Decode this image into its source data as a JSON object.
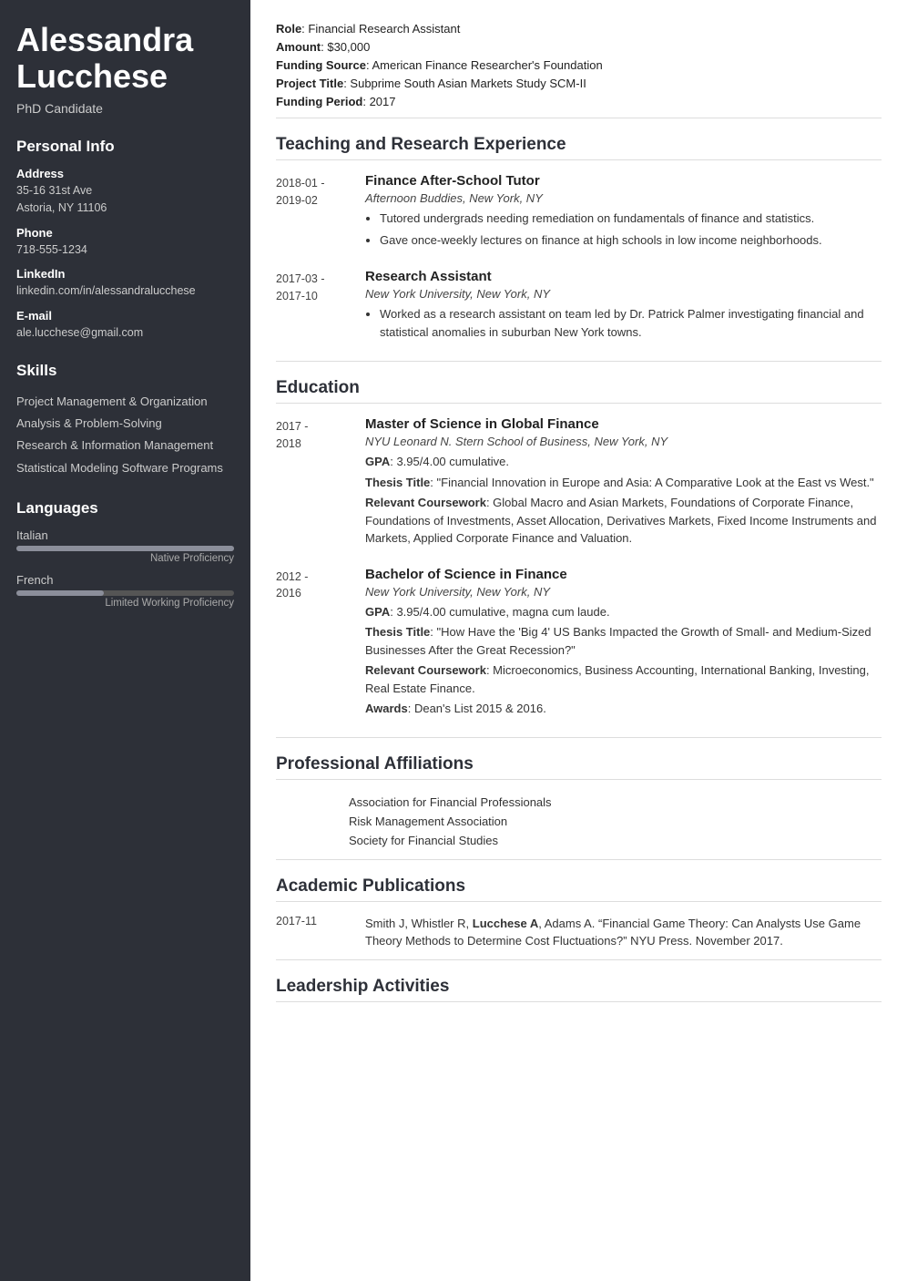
{
  "sidebar": {
    "name": "Alessandra Lucchese",
    "title": "PhD Candidate",
    "personal_info": {
      "section_title": "Personal Info",
      "address_label": "Address",
      "address_line1": "35-16 31st Ave",
      "address_line2": "Astoria, NY 11106",
      "phone_label": "Phone",
      "phone": "718-555-1234",
      "linkedin_label": "LinkedIn",
      "linkedin": "linkedin.com/in/alessandralucchese",
      "email_label": "E-mail",
      "email": "ale.lucchese@gmail.com"
    },
    "skills": {
      "section_title": "Skills",
      "items": [
        "Project Management & Organization",
        "Analysis & Problem-Solving",
        "Research & Information Management",
        "Statistical Modeling Software Programs"
      ]
    },
    "languages": {
      "section_title": "Languages",
      "items": [
        {
          "name": "Italian",
          "fill_pct": 100,
          "proficiency": "Native Proficiency"
        },
        {
          "name": "French",
          "fill_pct": 40,
          "proficiency": "Limited Working Proficiency"
        }
      ]
    }
  },
  "main": {
    "funding": {
      "role_label": "Role",
      "role": "Financial Research Assistant",
      "amount_label": "Amount",
      "amount": "$30,000",
      "funding_source_label": "Funding Source",
      "funding_source": "American Finance Researcher's Foundation",
      "project_title_label": "Project Title",
      "project_title": "Subprime South Asian Markets Study SCM-II",
      "funding_period_label": "Funding Period",
      "funding_period": "2017"
    },
    "teaching_section_title": "Teaching and Research Experience",
    "teaching": [
      {
        "date_start": "2018-01 -",
        "date_end": "2019-02",
        "title": "Finance After-School Tutor",
        "org": "Afternoon Buddies, New York, NY",
        "bullets": [
          "Tutored undergrads needing remediation on fundamentals of finance and statistics.",
          "Gave once-weekly lectures on finance at high schools in low income neighborhoods."
        ]
      },
      {
        "date_start": "2017-03 -",
        "date_end": "2017-10",
        "title": "Research Assistant",
        "org": "New York University, New York, NY",
        "bullets": [
          "Worked as a research assistant on team led by Dr. Patrick Palmer investigating financial and statistical anomalies in suburban New York towns."
        ]
      }
    ],
    "education_section_title": "Education",
    "education": [
      {
        "date_start": "2017 -",
        "date_end": "2018",
        "title": "Master of Science in Global Finance",
        "org": "NYU Leonard N. Stern School of Business, New York, NY",
        "gpa_label": "GPA",
        "gpa": "3.95/4.00 cumulative.",
        "thesis_label": "Thesis Title",
        "thesis": "\"Financial Innovation in Europe and Asia: A Comparative Look at the East vs West.\"",
        "coursework_label": "Relevant Coursework",
        "coursework": "Global Macro and Asian Markets, Foundations of Corporate Finance, Foundations of Investments, Asset Allocation, Derivatives Markets, Fixed Income Instruments and Markets, Applied Corporate Finance and Valuation.",
        "awards_label": null,
        "awards": null
      },
      {
        "date_start": "2012 -",
        "date_end": "2016",
        "title": "Bachelor of Science in Finance",
        "org": "New York University, New York, NY",
        "gpa_label": "GPA",
        "gpa": "3.95/4.00 cumulative, magna cum laude.",
        "thesis_label": "Thesis Title",
        "thesis": "\"How Have the 'Big 4' US Banks Impacted the Growth of Small- and Medium-Sized Businesses After the Great Recession?\"",
        "coursework_label": "Relevant Coursework",
        "coursework": "Microeconomics, Business Accounting, International Banking, Investing, Real Estate Finance.",
        "awards_label": "Awards",
        "awards": "Dean's List 2015 & 2016."
      }
    ],
    "affiliations_section_title": "Professional Affiliations",
    "affiliations": [
      "Association for Financial Professionals",
      "Risk Management Association",
      "Society for Financial Studies"
    ],
    "publications_section_title": "Academic Publications",
    "publications": [
      {
        "date": "2017-11",
        "text_parts": [
          {
            "text": "Smith J, Whistler R, ",
            "bold": false
          },
          {
            "text": "Lucchese A",
            "bold": true
          },
          {
            "text": ", Adams A. “Financial Game Theory: Can Analysts Use Game Theory Methods to Determine Cost Fluctuations?” NYU Press. November 2017.",
            "bold": false
          }
        ]
      }
    ],
    "leadership_section_title": "Leadership Activities"
  }
}
